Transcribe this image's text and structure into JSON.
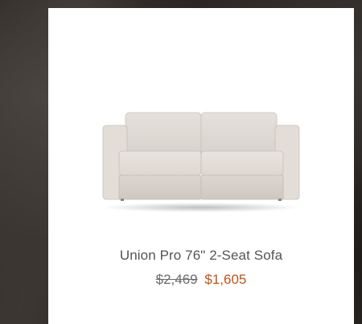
{
  "product": {
    "name": "Union Pro 76\" 2-Seat Sofa",
    "original_price": "$2,469",
    "sale_price": "$1,605",
    "image_icon": "sofa-image"
  },
  "colors": {
    "sale_price": "#c0531b",
    "original_price": "#6b6b6b",
    "name": "#555555",
    "card_background": "#ffffff"
  }
}
